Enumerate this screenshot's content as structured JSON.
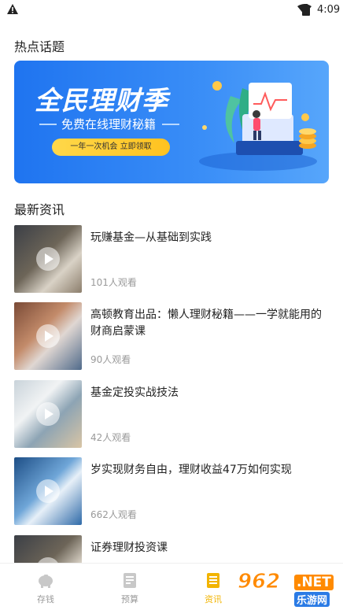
{
  "status_bar": {
    "time": "4:09"
  },
  "sections": {
    "hot_topics": "热点话题",
    "latest_news": "最新资讯"
  },
  "banner": {
    "headline": "全民理财季",
    "subtitle": "免费在线理财秘籍",
    "pill": "一年一次机会 立即领取"
  },
  "news": [
    {
      "title": "玩赚基金—从基础到实践",
      "views": "101人观看"
    },
    {
      "title": "高顿教育出品：懒人理财秘籍——一学就能用的财商启蒙课",
      "views": "90人观看"
    },
    {
      "title": "基金定投实战技法",
      "views": "42人观看"
    },
    {
      "title": "岁实现财务自由，理财收益47万如何实现",
      "views": "662人观看"
    },
    {
      "title": "证券理财投资课",
      "views": ""
    }
  ],
  "bottom_nav": [
    {
      "label": "存钱",
      "icon": "piggy-bank-icon",
      "active": false
    },
    {
      "label": "预算",
      "icon": "budget-icon",
      "active": false
    },
    {
      "label": "资讯",
      "icon": "news-icon",
      "active": true
    }
  ],
  "watermark": {
    "number": "962",
    "net": ".NET",
    "site": "乐游网"
  },
  "colors": {
    "accent": "#f2b400",
    "banner_blue": "#1f74f0"
  }
}
